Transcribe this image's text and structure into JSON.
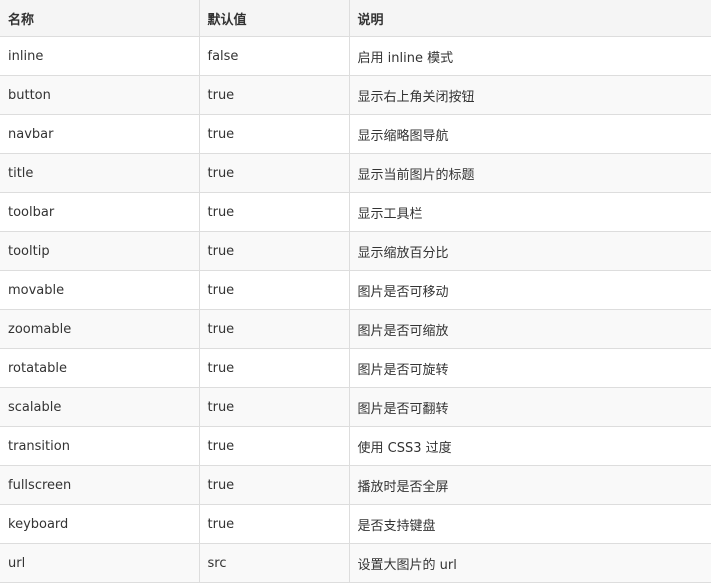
{
  "table": {
    "headers": [
      "名称",
      "默认值",
      "说明"
    ],
    "rows": [
      {
        "name": "inline",
        "default": "false",
        "desc": "启用 inline 模式"
      },
      {
        "name": "button",
        "default": "true",
        "desc": "显示右上角关闭按钮"
      },
      {
        "name": "navbar",
        "default": "true",
        "desc": "显示缩略图导航"
      },
      {
        "name": "title",
        "default": "true",
        "desc": "显示当前图片的标题"
      },
      {
        "name": "toolbar",
        "default": "true",
        "desc": "显示工具栏"
      },
      {
        "name": "tooltip",
        "default": "true",
        "desc": "显示缩放百分比"
      },
      {
        "name": "movable",
        "default": "true",
        "desc": "图片是否可移动"
      },
      {
        "name": "zoomable",
        "default": "true",
        "desc": "图片是否可缩放"
      },
      {
        "name": "rotatable",
        "default": "true",
        "desc": "图片是否可旋转"
      },
      {
        "name": "scalable",
        "default": "true",
        "desc": "图片是否可翻转"
      },
      {
        "name": "transition",
        "default": "true",
        "desc": "使用 CSS3 过度"
      },
      {
        "name": "fullscreen",
        "default": "true",
        "desc": "播放时是否全屏"
      },
      {
        "name": "keyboard",
        "default": "true",
        "desc": "是否支持键盘"
      },
      {
        "name": "url",
        "default": "src",
        "desc": "设置大图片的 url"
      }
    ]
  }
}
